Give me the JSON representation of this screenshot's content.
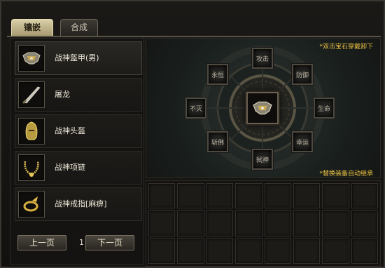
{
  "tabs": [
    {
      "label": "镶嵌",
      "active": true
    },
    {
      "label": "合成",
      "active": false
    }
  ],
  "equipment_list": [
    {
      "name": "战神盔甲(男)",
      "icon": "armor-icon",
      "selected": true
    },
    {
      "name": "屠龙",
      "icon": "sword-icon",
      "selected": false
    },
    {
      "name": "战神头盔",
      "icon": "helmet-icon",
      "selected": false
    },
    {
      "name": "战神项链",
      "icon": "necklace-icon",
      "selected": false
    },
    {
      "name": "战神戒指[麻痹]",
      "icon": "ring-icon",
      "selected": false
    }
  ],
  "pager": {
    "prev_label": "上一页",
    "next_label": "下一页",
    "page": "1"
  },
  "socket_panel": {
    "hint_top": "*双击宝石穿戴卸下",
    "hint_bottom": "*替换装备自动继承",
    "center_item_icon": "armor-icon",
    "sockets": [
      "攻击",
      "防御",
      "生命",
      "幸运",
      "弑神",
      "斩佛",
      "不灭",
      "永恒"
    ]
  },
  "bag": {
    "cells": 24
  },
  "colors": {
    "hint": "#e8c040",
    "tab_active": "#d8cfa8"
  }
}
